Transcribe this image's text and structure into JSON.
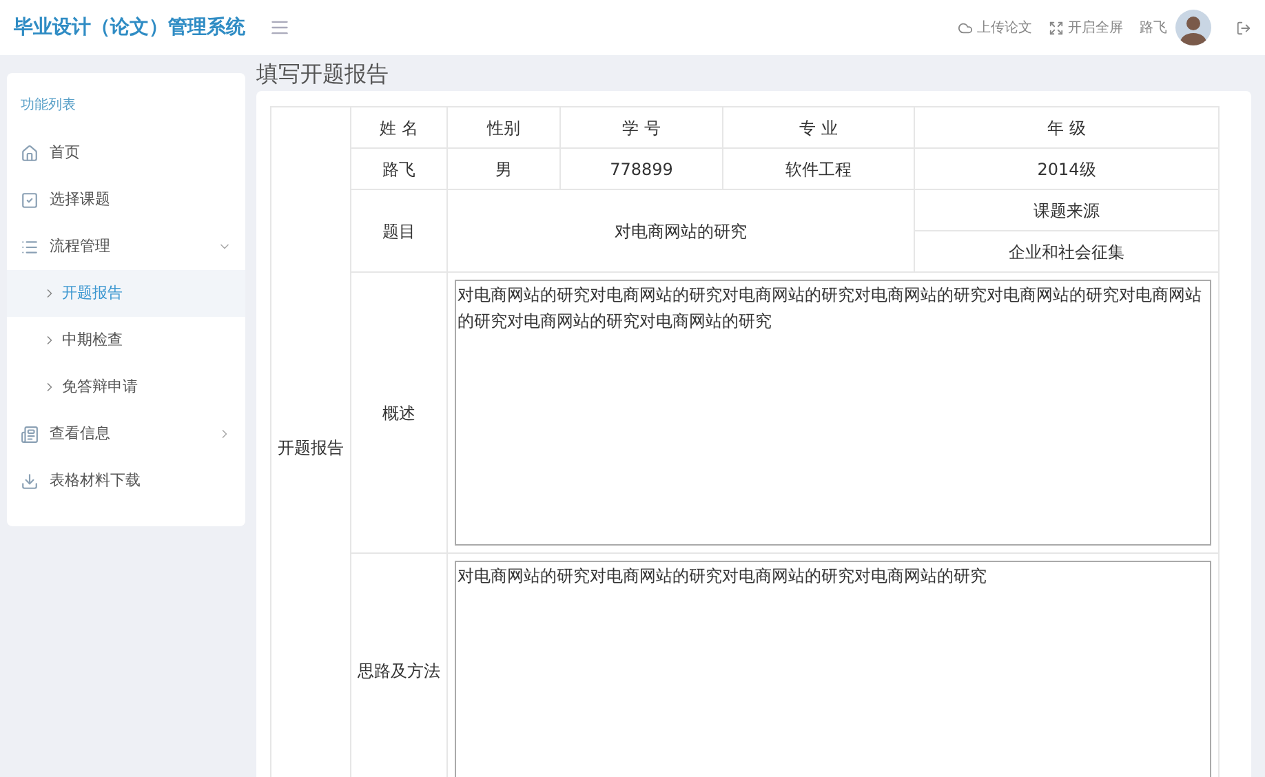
{
  "header": {
    "title": "毕业设计（论文）管理系统",
    "actions": [
      {
        "kind": "upload",
        "label": "上传论文"
      },
      {
        "kind": "fullscreen",
        "label": "开启全屏"
      }
    ],
    "user": "路飞"
  },
  "sidebar": {
    "heading": "功能列表",
    "items": [
      {
        "kind": "home",
        "label": "首页"
      },
      {
        "kind": "check",
        "label": "选择课题"
      },
      {
        "kind": "list",
        "label": "流程管理",
        "expanded": true,
        "children": [
          {
            "label": "开题报告",
            "selected": true
          },
          {
            "label": "中期检查",
            "selected": false
          },
          {
            "label": "免答辩申请",
            "selected": false
          }
        ]
      },
      {
        "kind": "info",
        "label": "查看信息",
        "expanded": false
      },
      {
        "kind": "download",
        "label": "表格材料下载"
      }
    ]
  },
  "page_title": "填写开题报告",
  "form": {
    "section_label": "开题报告",
    "header_cells": [
      "姓 名",
      "性别",
      "学 号",
      "专 业",
      "年 级"
    ],
    "value_cells": [
      "路飞",
      "男",
      "778899",
      "软件工程",
      "2014级"
    ],
    "topic_label": "题目",
    "topic": "对电商网站的研究",
    "source_label": "课题来源",
    "source": "企业和社会征集",
    "fields": [
      {
        "label": "概述",
        "value": "对电商网站的研究对电商网站的研究对电商网站的研究对电商网站的研究对电商网站的研究对电商网站的研究对电商网站的研究对电商网站的研究"
      },
      {
        "label": "思路及方法",
        "value": "对电商网站的研究对电商网站的研究对电商网站的研究对电商网站的研究"
      }
    ]
  }
}
